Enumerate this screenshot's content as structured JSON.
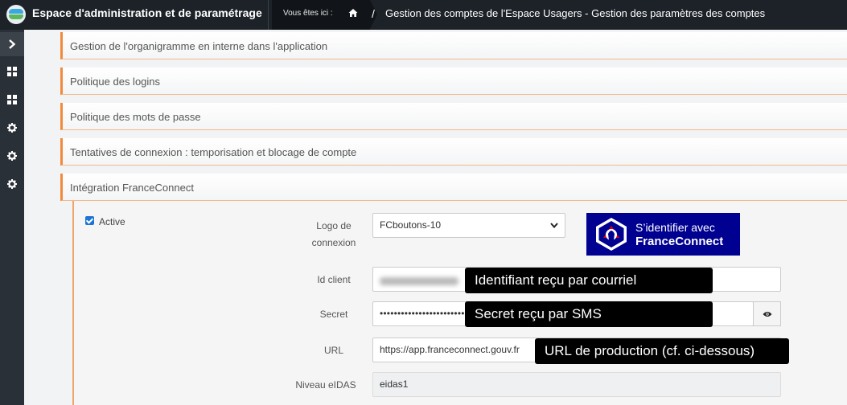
{
  "header": {
    "app_title": "Espace d'administration et de paramétrage",
    "breadcrumb_label": "Vous êtes ici :",
    "breadcrumb_separator": "/",
    "breadcrumb_page": "Gestion des comptes de l'Espace Usagers - Gestion des paramètres des comptes"
  },
  "sidebar": {
    "icons": [
      "chevron-right-icon",
      "grid-icon",
      "grid-icon",
      "gear-icon",
      "gear-icon",
      "gear-icon"
    ]
  },
  "sections": [
    "Gestion de l'organigramme en interne dans l'application",
    "Politique des logins",
    "Politique des mots de passe",
    "Tentatives de connexion : temporisation et blocage de compte",
    "Intégration FranceConnect"
  ],
  "franceconnect": {
    "active_label": "Active",
    "active_checked": true,
    "logo_label_line1": "Logo de",
    "logo_label_line2": "connexion",
    "logo_value": "FCboutons-10",
    "button_line1": "S’identifier avec",
    "button_line2": "FranceConnect",
    "id_client_label": "Id client",
    "secret_label": "Secret",
    "secret_value": "••••••••••••••••••••••••••",
    "url_label": "URL",
    "url_value": "https://app.franceconnect.gouv.fr",
    "eidas_label": "Niveau eIDAS",
    "eidas_value": "eidas1"
  },
  "annotations": {
    "id_tip": "Identifiant reçu par courriel",
    "secret_tip": "Secret reçu par SMS",
    "url_tip": "URL de production (cf. ci-dessous)"
  },
  "colors": {
    "accent_orange": "#f08a3c",
    "franceconnect_blue": "#000091",
    "header_dark": "#1c2228"
  }
}
